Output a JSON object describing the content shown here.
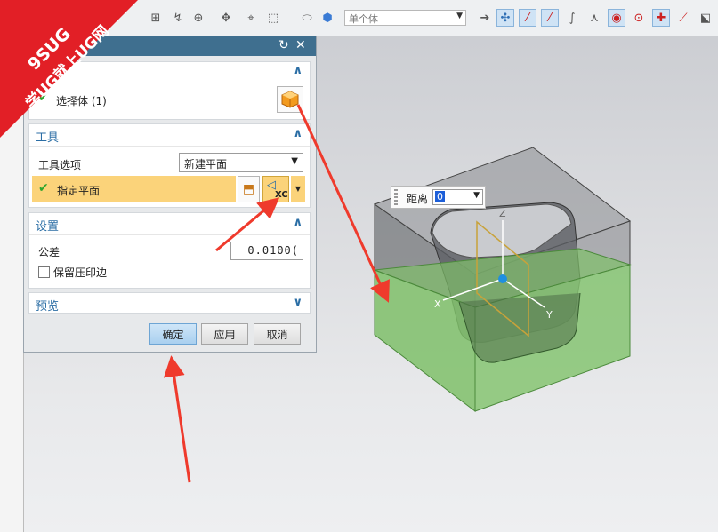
{
  "watermark": {
    "line1": "9SUG",
    "line2": "学UG就上UG网"
  },
  "toolbar": {
    "filter_value": "单个体",
    "accent": "#cfe3f5"
  },
  "dialog": {
    "select_body": {
      "label": "选择体 (1)"
    },
    "tools": {
      "header": "工具",
      "option_label": "工具选项",
      "option_value": "新建平面",
      "plane_label": "指定平面",
      "plane_button_text": "XC"
    },
    "settings": {
      "header": "设置",
      "tolerance_label": "公差",
      "tolerance_value": "0.0100(",
      "keep_imprint_label": "保留压印边"
    },
    "preview": {
      "header": "预览"
    },
    "buttons": {
      "ok": "确定",
      "apply": "应用",
      "cancel": "取消"
    }
  },
  "float_distance": {
    "label": "距离",
    "value": "0"
  },
  "axes": {
    "x": "X",
    "y": "Y",
    "z": "Z"
  },
  "colors": {
    "title_bar": "#3f6f8f",
    "highlight_row": "#fbd37a",
    "green_body": "#7fbf6a",
    "arrow": "#ef3a2c"
  }
}
